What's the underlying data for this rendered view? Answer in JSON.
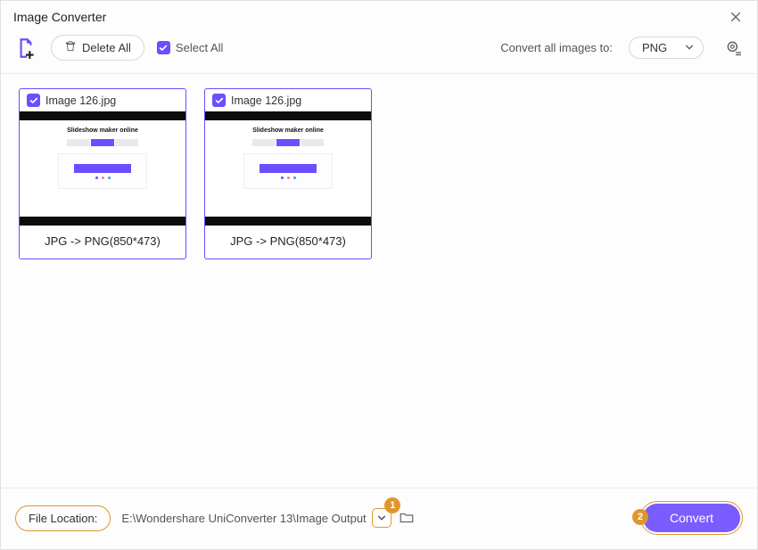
{
  "window": {
    "title": "Image Converter"
  },
  "toolbar": {
    "delete_all_label": "Delete All",
    "select_all_label": "Select All",
    "convert_label": "Convert all images to:",
    "format_selected": "PNG"
  },
  "items": [
    {
      "filename": "Image 126.jpg",
      "thumb_heading": "Slideshow maker online",
      "conversion": "JPG -> PNG(850*473)",
      "checked": true
    },
    {
      "filename": "Image 126.jpg",
      "thumb_heading": "Slideshow maker online",
      "conversion": "JPG -> PNG(850*473)",
      "checked": true
    }
  ],
  "footer": {
    "file_location_label": "File Location:",
    "file_location_path": "E:\\Wondershare UniConverter 13\\Image Output",
    "convert_button": "Convert"
  },
  "annotations": {
    "marker1": "1",
    "marker2": "2"
  },
  "colors": {
    "accent": "#6b4eff",
    "annotation": "#e0962f"
  }
}
